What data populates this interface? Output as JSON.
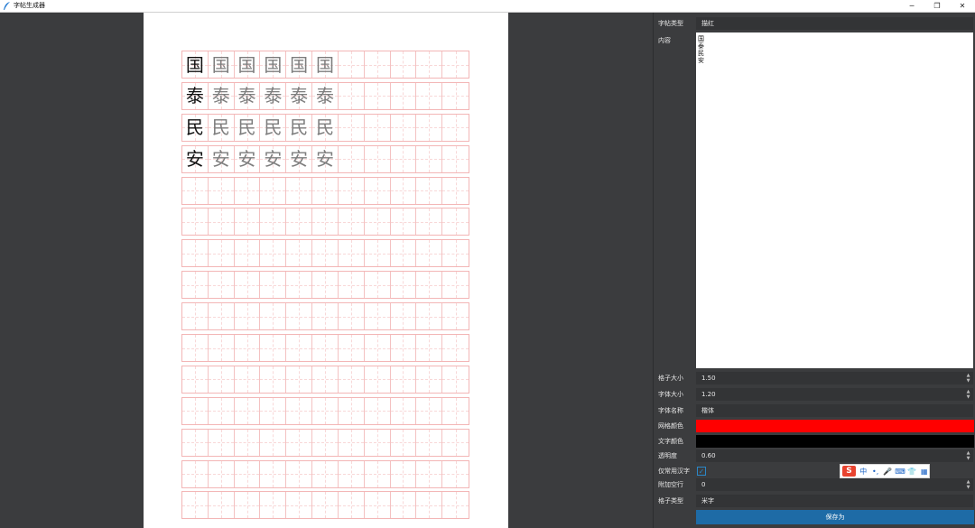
{
  "window": {
    "title": "字帖生成器",
    "controls": {
      "minimize": "─",
      "restore": "❐",
      "close": "✕"
    }
  },
  "paper": {
    "columns": 11,
    "row_count": 15,
    "rows": [
      {
        "char": "国",
        "copies": 6
      },
      {
        "char": "泰",
        "copies": 6
      },
      {
        "char": "民",
        "copies": 6
      },
      {
        "char": "安",
        "copies": 6
      }
    ]
  },
  "panel": {
    "type": {
      "label": "字帖类型",
      "value": "描红"
    },
    "content": {
      "label": "内容",
      "value": "国\n泰\n民\n安"
    },
    "cell_size": {
      "label": "格子大小",
      "value": "1.50"
    },
    "font_size": {
      "label": "字体大小",
      "value": "1.20"
    },
    "font_name": {
      "label": "字体名称",
      "value": "楷体"
    },
    "grid_color": {
      "label": "网格颜色",
      "color": "#ff0000"
    },
    "text_color": {
      "label": "文字颜色",
      "color": "#000000"
    },
    "opacity": {
      "label": "透明度",
      "value": "0.60"
    },
    "common_only": {
      "label": "仅常用汉字",
      "checked": true
    },
    "extra_rows": {
      "label": "附加空行",
      "value": "0"
    },
    "grid_type": {
      "label": "格子类型",
      "value": "米字"
    },
    "save_label": "保存为"
  },
  "ime": {
    "logo": "S",
    "items": [
      "中",
      "•,",
      "🎤",
      "⌨",
      "👕",
      "▦"
    ]
  },
  "colors": {
    "accent": "#1e6ba6",
    "background": "#3b3c3e",
    "grid": "#f4c2c2"
  }
}
